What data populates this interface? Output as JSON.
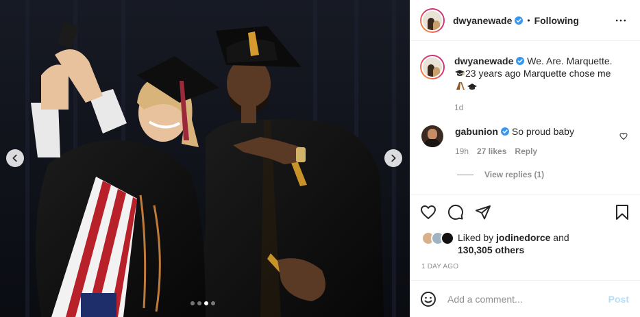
{
  "post": {
    "author": "dwyanewade",
    "follow_state": "Following",
    "separator": "•",
    "caption_line1": "We. Are. Marquette.",
    "caption_line2": "23 years ago Marquette chose me",
    "caption_time": "1d",
    "icons": {
      "verified": "verified-badge-icon",
      "more": "more-options-icon",
      "prev": "chevron-left-icon",
      "next": "chevron-right-icon"
    }
  },
  "carousel": {
    "slide_count": 4,
    "active_index": 2
  },
  "comment": {
    "author": "gabunion",
    "text": "So proud baby",
    "time": "19h",
    "likes": "27 likes",
    "reply_label": "Reply",
    "view_replies": "View replies (1)"
  },
  "actions": {
    "icons": [
      "heart-icon",
      "comment-icon",
      "share-icon",
      "bookmark-icon"
    ]
  },
  "likes": {
    "prefix": "Liked by",
    "user": "jodinedorce",
    "conjunction": "and",
    "others": "130,305 others"
  },
  "date_label": "1 DAY AGO",
  "add_comment": {
    "placeholder": "Add a comment...",
    "post_label": "Post"
  },
  "colors": {
    "verified": "#3897f0",
    "post_button_disabled": "#b2dffc",
    "meta_gray": "#8e8e8e",
    "ring_start": "#f9a236",
    "ring_end": "#c13584"
  }
}
